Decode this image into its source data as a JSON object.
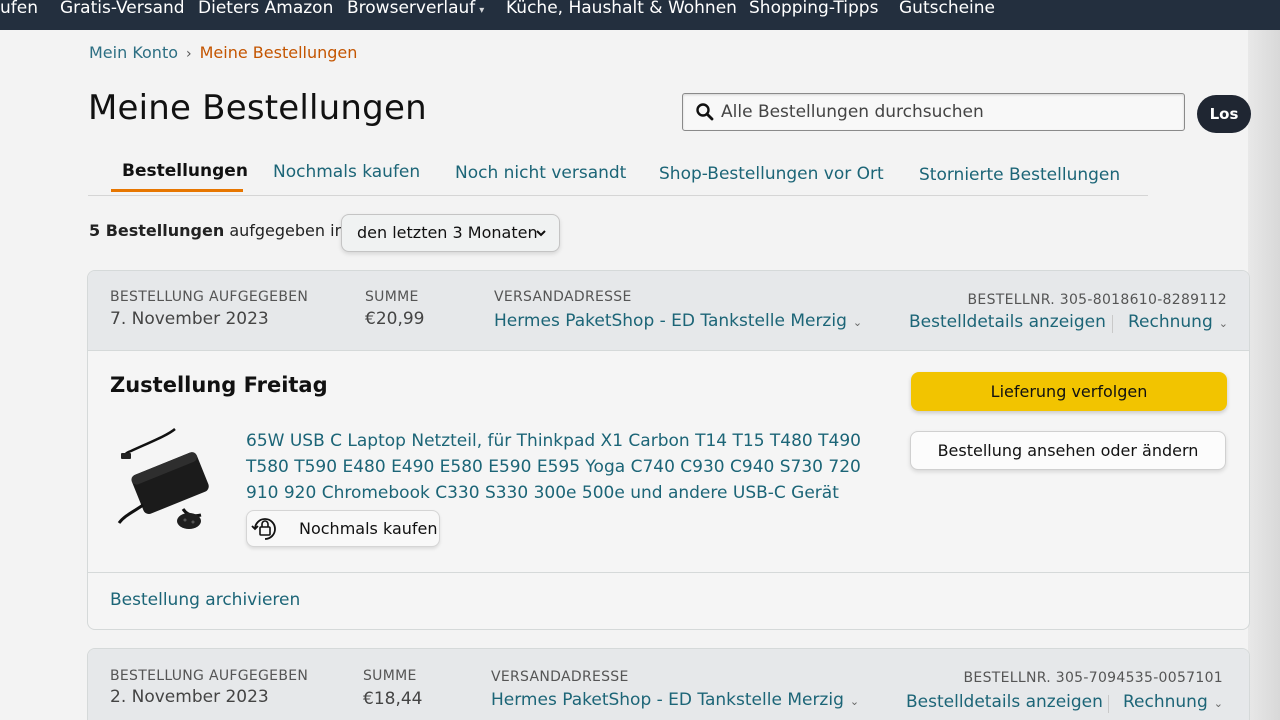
{
  "nav": {
    "items": [
      "ufen",
      "Gratis-Versand",
      "Dieters Amazon",
      "Browserverlauf",
      "Küche, Haushalt & Wohnen",
      "Shopping-Tipps",
      "Gutscheine"
    ]
  },
  "breadcrumb": {
    "account": "Mein Konto",
    "separator": "›",
    "current": "Meine Bestellungen"
  },
  "page_title": "Meine Bestellungen",
  "search": {
    "placeholder": "Alle Bestellungen durchsuchen",
    "button": "Los"
  },
  "tabs": [
    {
      "label": "Bestellungen",
      "active": true
    },
    {
      "label": "Nochmals kaufen"
    },
    {
      "label": "Noch nicht versandt"
    },
    {
      "label": "Shop-Bestellungen vor Ort"
    },
    {
      "label": "Stornierte Bestellungen"
    }
  ],
  "summary": {
    "count_bold": "5 Bestellungen",
    "count_rest": "aufgegeben in",
    "range": "den letzten 3 Monaten"
  },
  "orders": [
    {
      "placed_label": "BESTELLUNG AUFGEGEBEN",
      "placed_date": "7. November 2023",
      "total_label": "SUMME",
      "total": "€20,99",
      "address_label": "VERSANDADRESSE",
      "address": "Hermes PaketShop - ED Tankstelle Merzig",
      "order_number": "BESTELLNR. 305-8018610-8289112",
      "details_link": "Bestelldetails anzeigen",
      "invoice_link": "Rechnung",
      "delivery": "Zustellung Freitag",
      "track_button": "Lieferung verfolgen",
      "view_button": "Bestellung ansehen oder ändern",
      "product": "65W USB C Laptop Netzteil, für Thinkpad X1 Carbon T14 T15 T480 T490 T580 T590 E480 E490 E580 E590 E595 Yoga C740 C930 C940 S730 720 910 920 Chromebook C330 S330 300e 500e und andere USB-C Gerät",
      "buy_again": "Nochmals kaufen",
      "archive": "Bestellung archivieren"
    },
    {
      "placed_label": "BESTELLUNG AUFGEGEBEN",
      "placed_date": "2. November 2023",
      "total_label": "SUMME",
      "total": "€18,44",
      "address_label": "VERSANDADRESSE",
      "address": "Hermes PaketShop - ED Tankstelle Merzig",
      "order_number": "BESTELLNR. 305-7094535-0057101",
      "details_link": "Bestelldetails anzeigen",
      "invoice_link": "Rechnung"
    }
  ],
  "icons": {
    "search": "search-icon",
    "chevron": "chevron-down-icon",
    "buy_again": "buy-again-icon",
    "product": "laptop-charger-image"
  },
  "colors": {
    "nav": "#232f3e",
    "link": "#1c6577",
    "accent": "#e77600",
    "track_button": "#f2c400",
    "breadcrumb_current": "#c45500"
  }
}
